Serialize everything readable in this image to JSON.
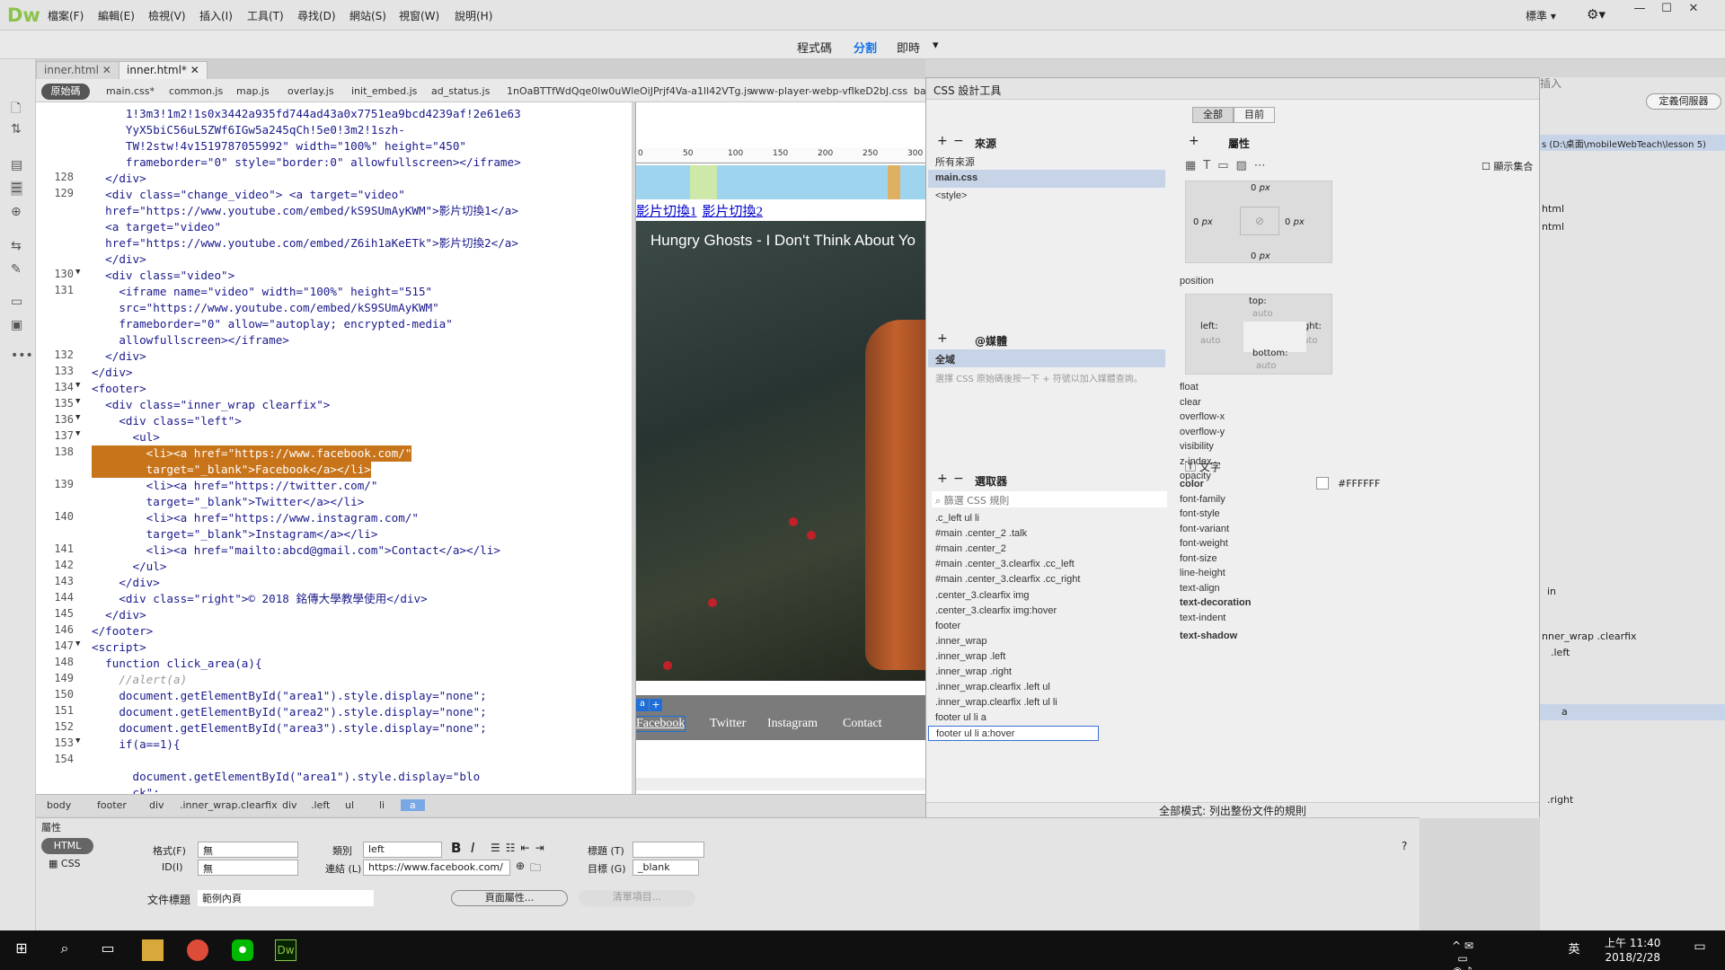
{
  "app": {
    "logo": "Dw"
  },
  "menu": [
    "檔案(F)",
    "編輯(E)",
    "檢視(V)",
    "插入(I)",
    "工具(T)",
    "尋找(D)",
    "網站(S)",
    "視窗(W)",
    "說明(H)"
  ],
  "workspace": "標準",
  "view_modes": [
    "程式碼",
    "分割",
    "即時"
  ],
  "doc_tabs": [
    "inner.html",
    "inner.html*"
  ],
  "related_files": [
    "原始碼",
    "main.css*",
    "common.js",
    "map.js",
    "overlay.js",
    "init_embed.js",
    "ad_status.js",
    "1nOaBTTfWdQqe0lw0uWleOiJPrjf4Va-a1lI42VTg.js",
    "www-player-webp-vflkeD2bJ.css",
    "ba"
  ],
  "code_lines": [
    {
      "n": "",
      "t": "     1!3m3!1m2!1s0x3442a935fd744ad43a0x7751ea9bcd4239af!2e61e63"
    },
    {
      "n": "",
      "t": "     YyX5biC56uL5ZWf6IGw5a245qCh!5e0!3m2!1szh-"
    },
    {
      "n": "",
      "t": "     TW!2stw!4v1519787055992\" width=\"100%\" height=\"450\""
    },
    {
      "n": "",
      "t": "     frameborder=\"0\" style=\"border:0\" allowfullscreen></iframe>"
    },
    {
      "n": "128",
      "t": "  </div>"
    },
    {
      "n": "129",
      "t": "  <div class=\"change_video\"> <a target=\"video\""
    },
    {
      "n": "",
      "t": "  href=\"https://www.youtube.com/embed/kS9SUmAyKWM\">影片切換1</a>"
    },
    {
      "n": "",
      "t": "  <a target=\"video\""
    },
    {
      "n": "",
      "t": "  href=\"https://www.youtube.com/embed/Z6ih1aKeETk\">影片切換2</a>"
    },
    {
      "n": "",
      "t": "  </div>"
    },
    {
      "n": "130",
      "t": "  <div class=\"video\">"
    },
    {
      "n": "131",
      "t": "    <iframe name=\"video\" width=\"100%\" height=\"515\""
    },
    {
      "n": "",
      "t": "    src=\"https://www.youtube.com/embed/kS9SUmAyKWM\""
    },
    {
      "n": "",
      "t": "    frameborder=\"0\" allow=\"autoplay; encrypted-media\""
    },
    {
      "n": "",
      "t": "    allowfullscreen></iframe>"
    },
    {
      "n": "132",
      "t": "  </div>"
    },
    {
      "n": "133",
      "t": "</div>"
    },
    {
      "n": "134",
      "t": "<footer>"
    },
    {
      "n": "135",
      "t": "  <div class=\"inner_wrap clearfix\">"
    },
    {
      "n": "136",
      "t": "    <div class=\"left\">"
    },
    {
      "n": "137",
      "t": "      <ul>"
    },
    {
      "n": "138",
      "t": "        <li><a href=\"https://www.facebook.com/\""
    },
    {
      "n": "",
      "t": "        target=\"_blank\">Facebook</a></li>"
    },
    {
      "n": "139",
      "t": "        <li><a href=\"https://twitter.com/\""
    },
    {
      "n": "",
      "t": "        target=\"_blank\">Twitter</a></li>"
    },
    {
      "n": "140",
      "t": "        <li><a href=\"https://www.instagram.com/\""
    },
    {
      "n": "",
      "t": "        target=\"_blank\">Instagram</a></li>"
    },
    {
      "n": "141",
      "t": "        <li><a href=\"mailto:abcd@gmail.com\">Contact</a></li>"
    },
    {
      "n": "142",
      "t": "      </ul>"
    },
    {
      "n": "143",
      "t": "    </div>"
    },
    {
      "n": "144",
      "t": "    <div class=\"right\">© 2018 銘傳大學教學使用</div>"
    },
    {
      "n": "145",
      "t": "  </div>"
    },
    {
      "n": "146",
      "t": "</footer>"
    },
    {
      "n": "147",
      "t": "<script>"
    },
    {
      "n": "148",
      "t": "  function click_area(a){"
    },
    {
      "n": "149",
      "t": "    //alert(a)"
    },
    {
      "n": "150",
      "t": "    document.getElementById(\"area1\").style.display=\"none\";"
    },
    {
      "n": "151",
      "t": "    document.getElementById(\"area2\").style.display=\"none\";"
    },
    {
      "n": "152",
      "t": "    document.getElementById(\"area3\").style.display=\"none\";"
    },
    {
      "n": "153",
      "t": "    if(a==1){"
    },
    {
      "n": "154",
      "t": ""
    },
    {
      "n": "",
      "t": "      document.getElementById(\"area1\").style.display=\"blo"
    },
    {
      "n": "",
      "t": "      ck\";"
    }
  ],
  "design": {
    "ruler": [
      "0",
      "50",
      "100",
      "150",
      "200",
      "250",
      "300"
    ],
    "video_links": [
      "影片切換1",
      "影片切換2"
    ],
    "video_title": "Hungry Ghosts - I Don't Think About Yo",
    "footer_links": [
      "Facebook",
      "Twitter",
      "Instagram",
      "Contact"
    ],
    "tag_badge": "a"
  },
  "css_designer": {
    "title": "CSS 設計工具",
    "toggle": [
      "全部",
      "目前"
    ],
    "sources_header": "來源",
    "sources": [
      "所有來源",
      "main.css",
      "<style>"
    ],
    "media_header": "@媒體",
    "media": [
      "全域"
    ],
    "media_hint": "選擇 CSS 原始碼後按一下 + 符號以加入媒體查詢。",
    "selectors_header": "選取器",
    "selector_filter": "篩選 CSS 規則",
    "selectors": [
      ".c_left ul li",
      "#main .center_2 .talk",
      "#main .center_2",
      "#main .center_3.clearfix .cc_left",
      "#main .center_3.clearfix .cc_right",
      ".center_3.clearfix img",
      ".center_3.clearfix img:hover",
      "footer",
      ".inner_wrap",
      ".inner_wrap .left",
      ".inner_wrap .right",
      ".inner_wrap.clearfix .left ul",
      ".inner_wrap.clearfix .left ul li",
      "footer ul li a",
      "footer ul li a:hover"
    ],
    "props_header": "屬性",
    "show_set": "顯示集合",
    "box": {
      "padding": "0",
      "unit": "px"
    },
    "position": {
      "label": "position",
      "top": "top:",
      "left": "left:",
      "right": "right:",
      "bottom": "bottom:",
      "auto": "auto"
    },
    "layout_props": [
      "float",
      "clear",
      "overflow-x",
      "overflow-y",
      "visibility",
      "z-index",
      "opacity"
    ],
    "text_section": "文字",
    "text_props": [
      "color",
      "font-family",
      "font-style",
      "font-variant",
      "font-weight",
      "font-size",
      "line-height",
      "text-align",
      "text-decoration",
      "text-indent",
      "text-shadow"
    ],
    "color_value": "#FFFFFF",
    "status": "全部模式: 列出整份文件的規則"
  },
  "right_panel": {
    "insert": "插入",
    "manage_sites": "定義伺服器",
    "path": "s (D:\\桌面\\mobileWebTeach\\lesson 5)",
    "files": [
      "html",
      "ntml"
    ],
    "dom": [
      "in",
      "nner_wrap .clearfix",
      ".left",
      "a",
      ".right"
    ]
  },
  "tag_selector": [
    "body",
    "footer",
    "div",
    ".inner_wrap.clearfix",
    "div",
    ".left",
    "ul",
    "li",
    "a"
  ],
  "properties": {
    "title": "屬性",
    "mode_html": "HTML",
    "mode_css": "CSS",
    "format_label": "格式(F)",
    "format_value": "無",
    "id_label": "ID(I)",
    "id_value": "無",
    "class_label": "類別",
    "class_value": "left",
    "link_label": "連結 (L)",
    "link_value": "https://www.facebook.com/",
    "title_label": "標題 (T)",
    "target_label": "目標 (G)",
    "target_value": "_blank",
    "doc_title_label": "文件標題",
    "doc_title_value": "範例內頁",
    "page_props": "頁面屬性...",
    "list_item": "清單項目..."
  },
  "taskbar": {
    "time": "上午 11:40",
    "date": "2018/2/28",
    "ime": "英"
  }
}
